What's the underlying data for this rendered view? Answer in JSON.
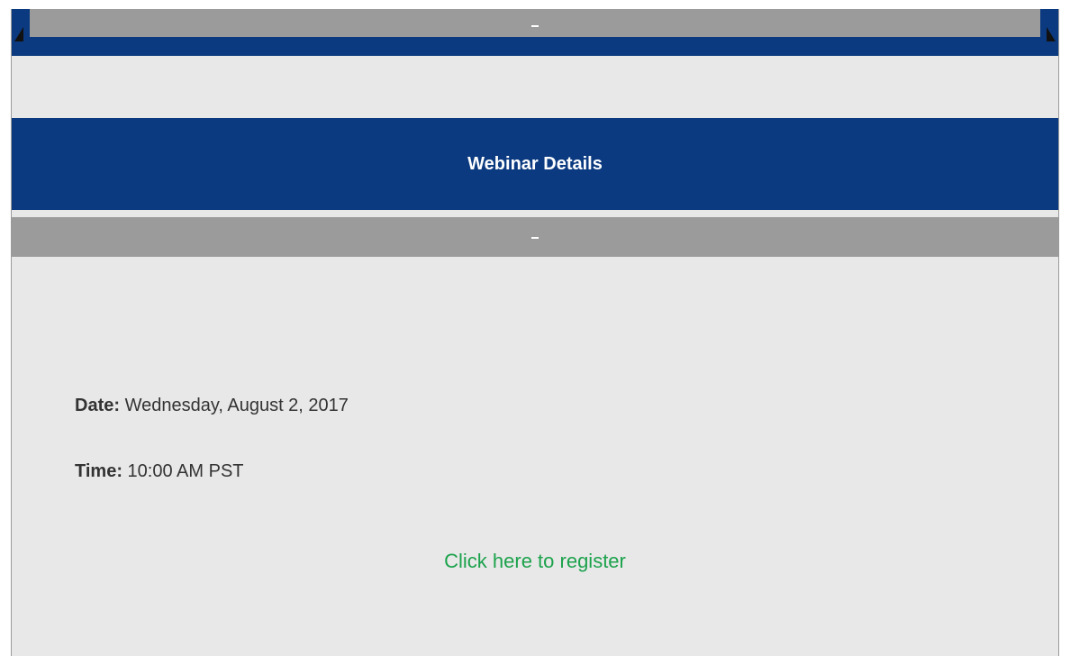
{
  "header": {
    "title": "Webinar Details"
  },
  "details": {
    "date_label": "Date:",
    "date_value": "Wednesday, August 2, 2017",
    "time_label": "Time:",
    "time_value": "10:00 AM PST"
  },
  "register": {
    "label": "Click here to register"
  },
  "colors": {
    "brand_blue": "#0b3a80",
    "band_gray": "#9b9b9b",
    "panel_bg": "#e8e8e8",
    "link_green": "#1ca24c"
  }
}
